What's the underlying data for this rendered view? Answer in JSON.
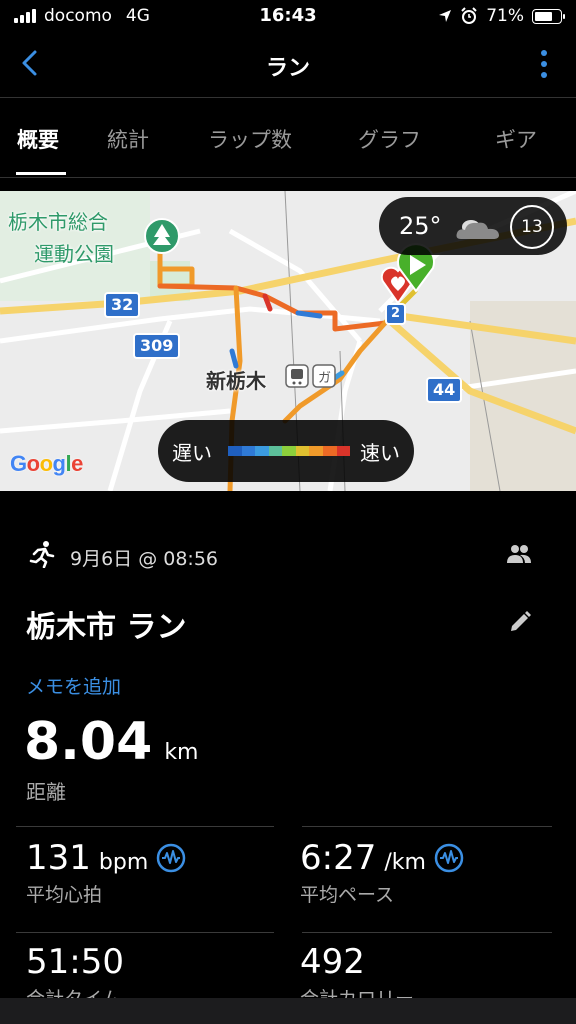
{
  "status": {
    "carrier": "docomo",
    "network": "4G",
    "time": "16:43",
    "battery": "71%",
    "battery_level": 0.71
  },
  "nav": {
    "title": "ラン"
  },
  "tabs": [
    {
      "label": "概要",
      "active": true
    },
    {
      "label": "統計",
      "active": false
    },
    {
      "label": "ラップ数",
      "active": false
    },
    {
      "label": "グラフ",
      "active": false
    },
    {
      "label": "ギア",
      "active": false
    }
  ],
  "map": {
    "poi": "栃木市総合\n運動公園",
    "poi_line1": "栃木市総合",
    "poi_line2": "運動公園",
    "station": "新栃木",
    "roads": [
      "32",
      "309",
      "44",
      "2"
    ],
    "attribution": "Google",
    "weather": {
      "temp": "25°",
      "wind": "13"
    },
    "speed_legend": {
      "slow": "遅い",
      "fast": "速い",
      "colors": [
        "#1f5fbf",
        "#2f7ad6",
        "#3b9be0",
        "#5cbf9a",
        "#8ccf3c",
        "#e0c030",
        "#f09a2a",
        "#ec6a25",
        "#d9342a"
      ]
    }
  },
  "activity": {
    "date": "9月6日 @ 08:56",
    "title": "栃木市 ラン",
    "memo_link": "メモを追加",
    "distance": {
      "value": "8.04",
      "unit": "km",
      "label": "距離"
    }
  },
  "stats": [
    {
      "value": "131",
      "unit": "bpm",
      "label": "平均心拍",
      "icon": "heart-rate-wave-icon"
    },
    {
      "value": "6:27",
      "unit": "/km",
      "label": "平均ペース",
      "icon": "pace-wave-icon"
    },
    {
      "value": "51:50",
      "unit": "",
      "label": "合計タイム"
    },
    {
      "value": "492",
      "unit": "",
      "label": "合計カロリー"
    }
  ],
  "colors": {
    "accent": "#3b8fe3",
    "background": "#000000",
    "park_green": "#2f9a6a"
  }
}
